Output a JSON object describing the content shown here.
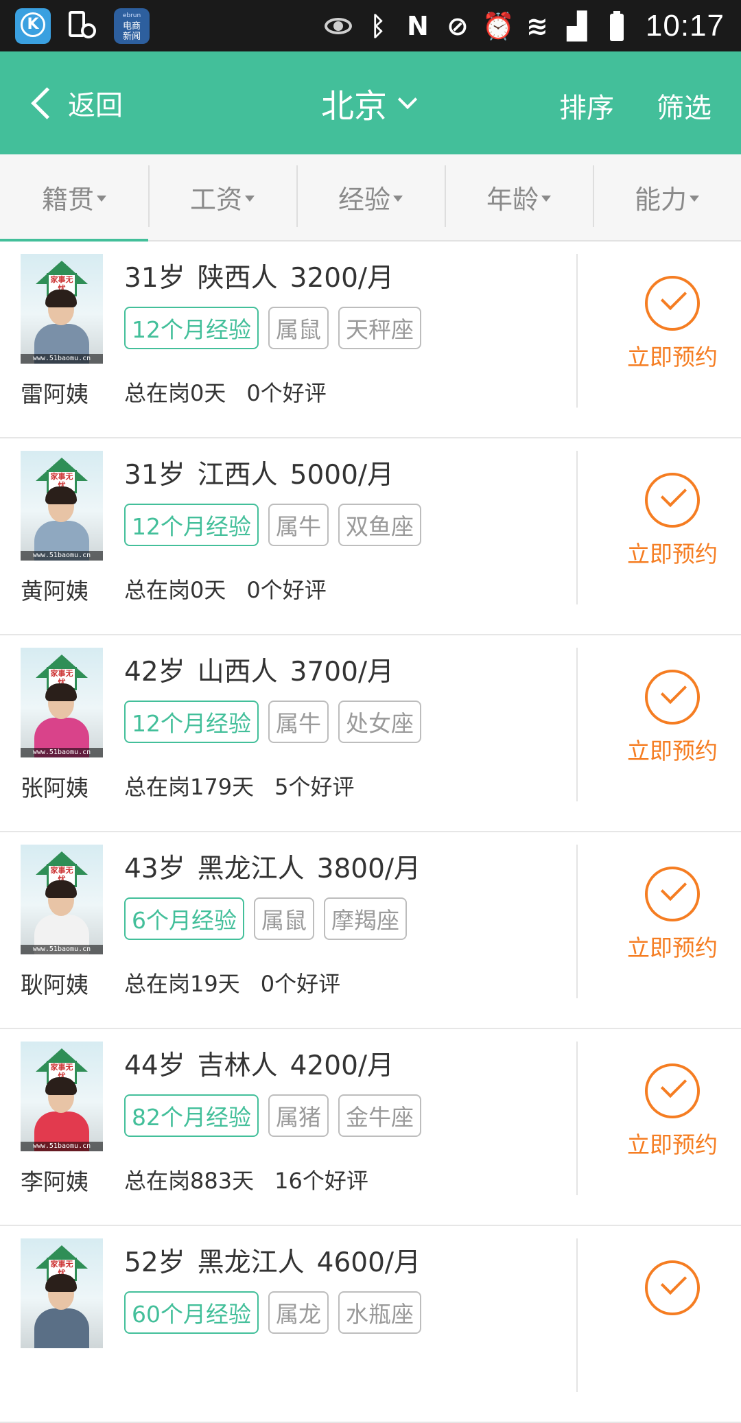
{
  "status_bar": {
    "time": "10:17",
    "news_app_line1": "ebrun",
    "news_app_line2": "电商",
    "news_app_line3": "新闻",
    "icons": [
      "k-app-icon",
      "phone-clock-icon",
      "news-app-icon",
      "eye-icon",
      "bluetooth-icon",
      "nfc-icon",
      "mute-icon",
      "alarm-icon",
      "wifi-icon",
      "signal-icon",
      "battery-icon"
    ]
  },
  "header": {
    "back_label": "返回",
    "city": "北京",
    "sort_label": "排序",
    "filter_label": "筛选",
    "bg_color": "#43bf9a"
  },
  "filters": [
    {
      "label": "籍贯"
    },
    {
      "label": "工资"
    },
    {
      "label": "经验"
    },
    {
      "label": "年龄"
    },
    {
      "label": "能力"
    }
  ],
  "accent_color": "#f57d22",
  "avatar_watermark": "www.51baomu.cn",
  "avatar_sign": "家事无忧",
  "items": [
    {
      "name": "雷阿姨",
      "age": "31岁",
      "origin": "陕西人",
      "salary": "3200/月",
      "experience": "12个月经验",
      "zodiac": "属鼠",
      "star_sign": "天秤座",
      "days": "总在岗0天",
      "reviews": "0个好评",
      "book_label": "立即预约"
    },
    {
      "name": "黄阿姨",
      "age": "31岁",
      "origin": "江西人",
      "salary": "5000/月",
      "experience": "12个月经验",
      "zodiac": "属牛",
      "star_sign": "双鱼座",
      "days": "总在岗0天",
      "reviews": "0个好评",
      "book_label": "立即预约"
    },
    {
      "name": "张阿姨",
      "age": "42岁",
      "origin": "山西人",
      "salary": "3700/月",
      "experience": "12个月经验",
      "zodiac": "属牛",
      "star_sign": "处女座",
      "days": "总在岗179天",
      "reviews": "5个好评",
      "book_label": "立即预约"
    },
    {
      "name": "耿阿姨",
      "age": "43岁",
      "origin": "黑龙江人",
      "salary": "3800/月",
      "experience": "6个月经验",
      "zodiac": "属鼠",
      "star_sign": "摩羯座",
      "days": "总在岗19天",
      "reviews": "0个好评",
      "book_label": "立即预约"
    },
    {
      "name": "李阿姨",
      "age": "44岁",
      "origin": "吉林人",
      "salary": "4200/月",
      "experience": "82个月经验",
      "zodiac": "属猪",
      "star_sign": "金牛座",
      "days": "总在岗883天",
      "reviews": "16个好评",
      "book_label": "立即预约"
    },
    {
      "name": "",
      "age": "52岁",
      "origin": "黑龙江人",
      "salary": "4600/月",
      "experience": "60个月经验",
      "zodiac": "属龙",
      "star_sign": "水瓶座",
      "days": "",
      "reviews": "",
      "book_label": ""
    }
  ]
}
